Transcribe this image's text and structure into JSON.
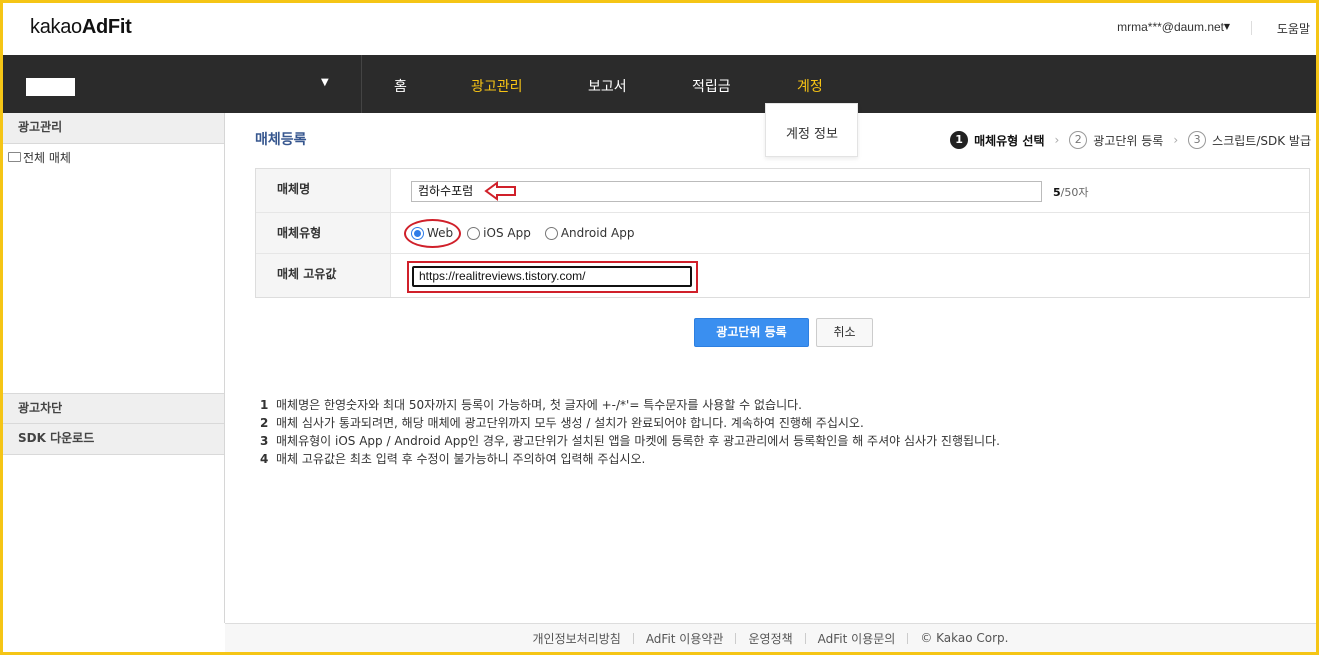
{
  "header": {
    "logo_regular": "kakao",
    "logo_bold": "AdFit",
    "user_email": "mrma***@daum.net",
    "help_label": "도움말"
  },
  "nav": {
    "items": [
      {
        "label": "홈",
        "active": false
      },
      {
        "label": "광고관리",
        "active": true
      },
      {
        "label": "보고서",
        "active": false
      },
      {
        "label": "적립금",
        "active": false
      },
      {
        "label": "계정",
        "active": true
      }
    ],
    "dropdown_item": "계정 정보",
    "active_color": "#f6c315"
  },
  "sidebar": {
    "section1": "광고관리",
    "tree_item": "전체 매체",
    "section2": "광고차단",
    "section3": "SDK 다운로드"
  },
  "main": {
    "title": "매체등록",
    "steps": [
      {
        "num": "1",
        "label": "매체유형 선택",
        "active": true
      },
      {
        "num": "2",
        "label": "광고단위 등록",
        "active": false
      },
      {
        "num": "3",
        "label": "스크립트/SDK 발급",
        "active": false
      }
    ],
    "form": {
      "name_label": "매체명",
      "name_value": "컴하수포럼",
      "name_count": "5",
      "name_max": "/50자",
      "type_label": "매체유형",
      "type_options": [
        "Web",
        "iOS App",
        "Android App"
      ],
      "type_selected": "Web",
      "unique_label": "매체 고유값",
      "unique_value": "https://realitreviews.tistory.com/"
    },
    "buttons": {
      "submit": "광고단위 등록",
      "cancel": "취소"
    },
    "notes": [
      {
        "n": "1",
        "text": "매체명은 한영숫자와 최대 50자까지 등록이 가능하며, 첫 글자에 +-/*'= 특수문자를 사용할 수 없습니다."
      },
      {
        "n": "2",
        "text": "매체 심사가 통과되려면, 해당 매체에 광고단위까지 모두 생성 / 설치가 완료되어야 합니다. 계속하여 진행해 주십시오."
      },
      {
        "n": "3",
        "text": "매체유형이 iOS App / Android App인 경우, 광고단위가 설치된 앱을 마켓에 등록한 후 광고관리에서 등록확인을 해 주셔야 심사가 진행됩니다."
      },
      {
        "n": "4",
        "text": "매체 고유값은 최초 입력 후 수정이 불가능하니 주의하여 입력해 주십시오."
      }
    ]
  },
  "footer": {
    "links": [
      "개인정보처리방침",
      "AdFit 이용약관",
      "운영정책",
      "AdFit 이용문의",
      "© Kakao Corp."
    ]
  },
  "colors": {
    "accent_blue": "#3a8ff0",
    "annotation_red": "#d0202a",
    "nav_bg": "#2b2b2b",
    "frame_yellow": "#f5c516"
  }
}
